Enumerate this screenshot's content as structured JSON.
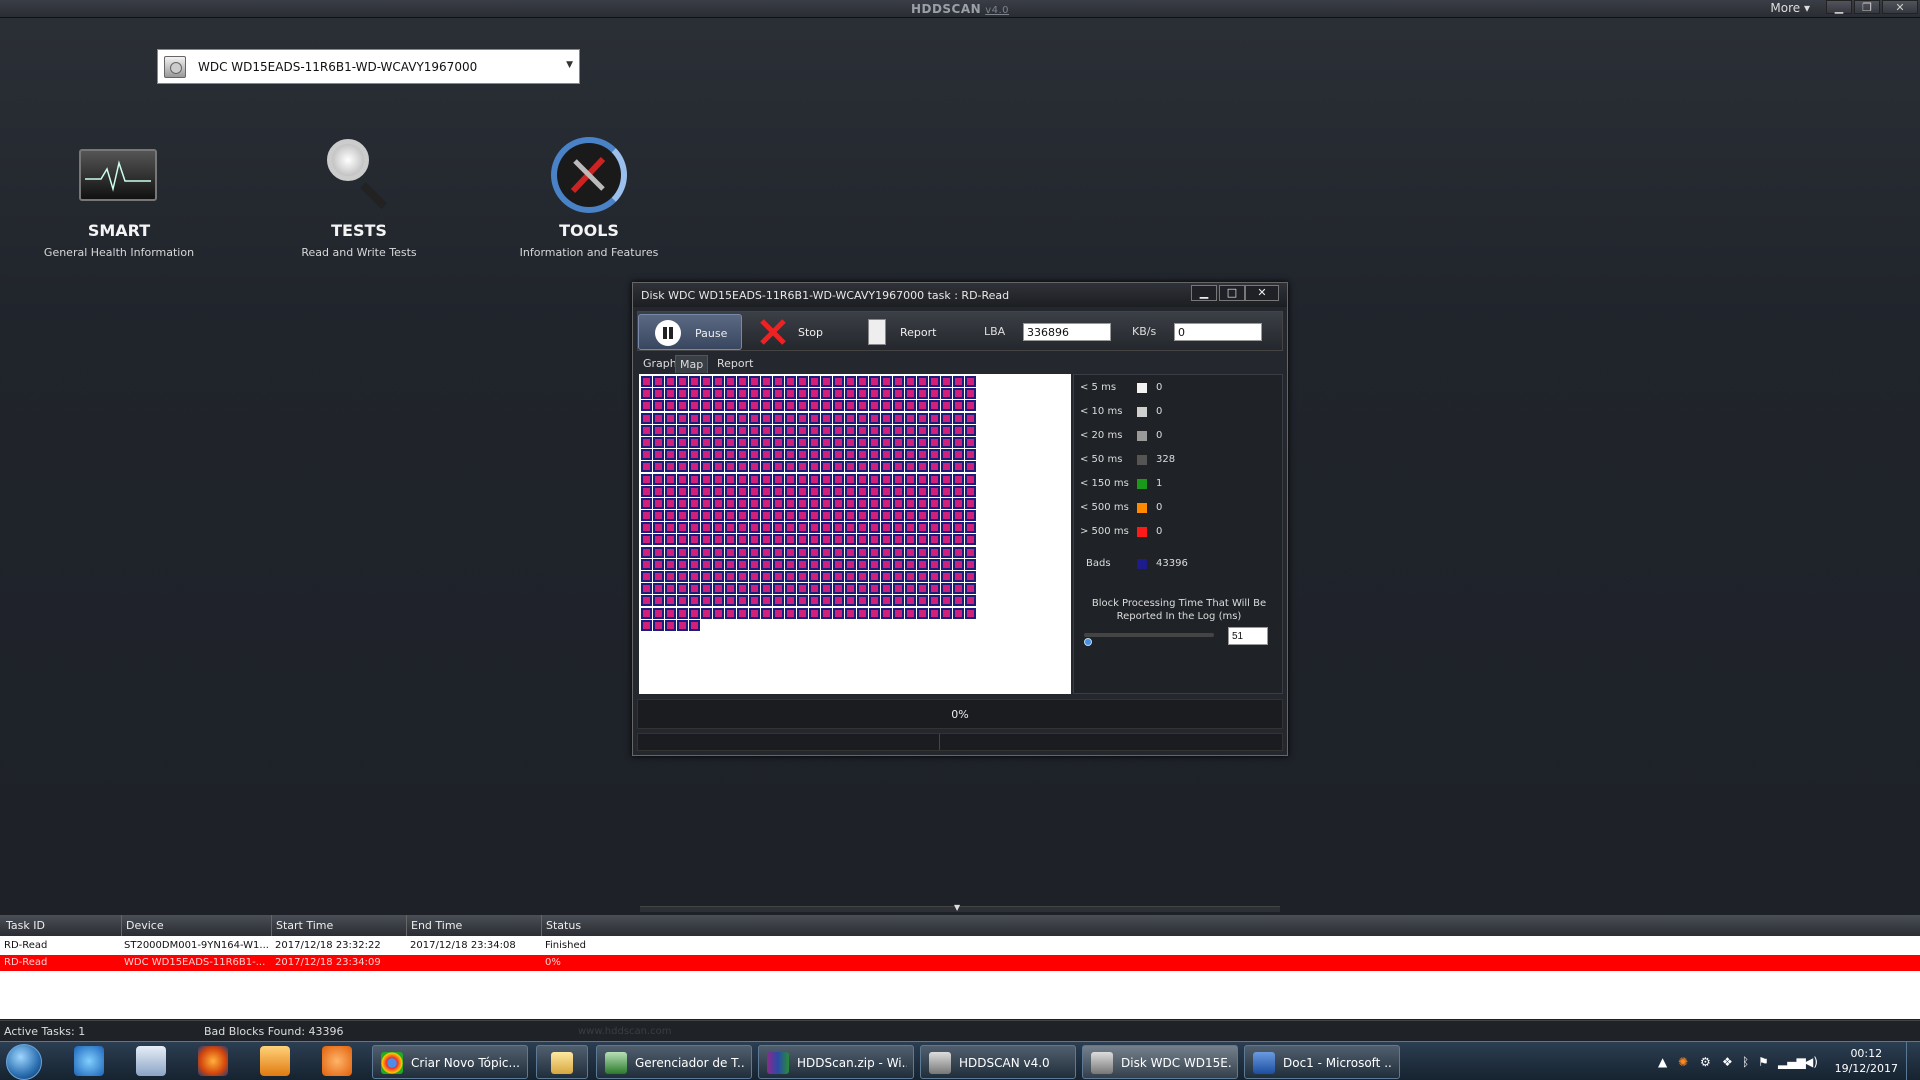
{
  "window": {
    "title": "HDDSCAN",
    "version": "v4.0",
    "more_label": "More ▾"
  },
  "device_select": {
    "value": "WDC WD15EADS-11R6B1-WD-WCAVY1967000"
  },
  "features": [
    {
      "title": "SMART",
      "subtitle": "General Health Information"
    },
    {
      "title": "TESTS",
      "subtitle": "Read and Write Tests"
    },
    {
      "title": "TOOLS",
      "subtitle": "Information and Features"
    }
  ],
  "dialog": {
    "title": "Disk WDC WD15EADS-11R6B1-WD-WCAVY1967000   task : RD-Read",
    "toolbar": {
      "pause_label": "Pause",
      "stop_label": "Stop",
      "report_label": "Report",
      "lba_label": "LBA",
      "lba_value": "336896",
      "kbs_label": "KB/s",
      "kbs_value": "0"
    },
    "tabs": [
      "Graph",
      "Map",
      "Report"
    ],
    "active_tab": "Map",
    "legend": [
      {
        "label": "< 5 ms",
        "color": "#f2f2f2",
        "count": "0"
      },
      {
        "label": "< 10 ms",
        "color": "#cfcfcf",
        "count": "0"
      },
      {
        "label": "< 20 ms",
        "color": "#9a9a9a",
        "count": "0"
      },
      {
        "label": "< 50 ms",
        "color": "#555555",
        "count": "328"
      },
      {
        "label": "< 150 ms",
        "color": "#1a9a1a",
        "count": "1"
      },
      {
        "label": "< 500 ms",
        "color": "#ff8a00",
        "count": "0"
      },
      {
        "label": "> 500 ms",
        "color": "#ff1a1a",
        "count": "0"
      },
      {
        "label": "Bads",
        "color": "#1c1c8a",
        "count": "43396"
      }
    ],
    "block_note": "Block Processing Time That Will Be Reported In the Log (ms)",
    "threshold_value": "51",
    "progress_text": "0%",
    "map_colors": {
      "bad_outer": "#1c1c7a",
      "bad_inner": "#d0207a"
    }
  },
  "tasks": {
    "columns": [
      "Task ID",
      "Device",
      "Start Time",
      "End Time",
      "Status"
    ],
    "rows": [
      {
        "task_id": "RD-Read",
        "device": "ST2000DM001-9YN164-W1...",
        "start": "2017/12/18 23:32:22",
        "end": "2017/12/18 23:34:08",
        "status": "Finished",
        "selected": false
      },
      {
        "task_id": "RD-Read",
        "device": "WDC WD15EADS-11R6B1-...",
        "start": "2017/12/18 23:34:09",
        "end": "",
        "status": "0%",
        "selected": true
      }
    ]
  },
  "status_bar": {
    "active_tasks": "Active Tasks: 1",
    "bad_blocks": "Bad Blocks Found: 43396",
    "watermark": "www.hddscan.com"
  },
  "taskbar": {
    "buttons": [
      {
        "label": "Criar Novo Tópic...",
        "icon": "chrome-icon"
      },
      {
        "label": "",
        "icon": "folder-icon"
      },
      {
        "label": "Gerenciador de T...",
        "icon": "task-manager-icon"
      },
      {
        "label": "HDDScan.zip - Wi...",
        "icon": "winrar-icon"
      },
      {
        "label": "HDDSCAN v4.0",
        "icon": "hddscan-icon"
      },
      {
        "label": "Disk WDC WD15E...",
        "icon": "hddscan-icon"
      },
      {
        "label": "Doc1 - Microsoft ...",
        "icon": "word-icon"
      }
    ],
    "clock_time": "00:12",
    "clock_date": "19/12/2017"
  }
}
